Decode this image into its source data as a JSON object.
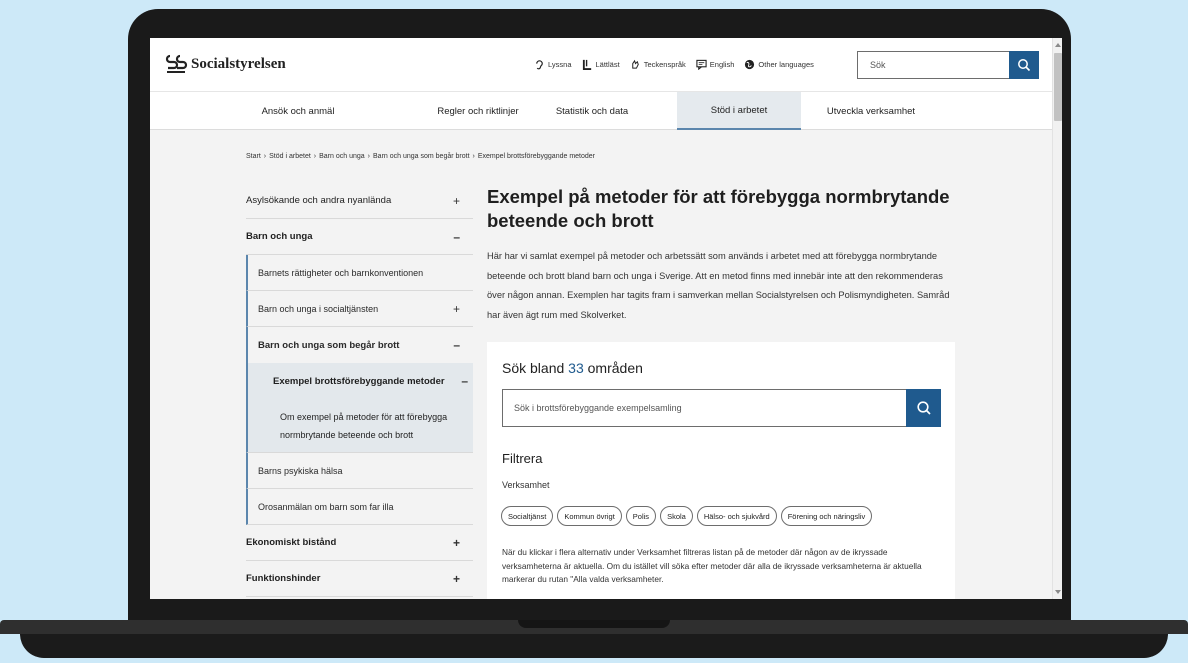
{
  "header": {
    "logo_text": "Socialstyrelsen",
    "tools": [
      {
        "icon": "ear-icon",
        "label": "Lyssna"
      },
      {
        "icon": "easy-read-icon",
        "label": "Lättläst"
      },
      {
        "icon": "sign-language-icon",
        "label": "Teckenspråk"
      },
      {
        "icon": "chat-bubble-icon",
        "label": "English"
      },
      {
        "icon": "globe-icon",
        "label": "Other languages"
      }
    ],
    "search_placeholder": "Sök"
  },
  "nav": {
    "items": [
      {
        "label": "Ansök och anmäl"
      },
      {
        "label": "Regler och riktlinjer"
      },
      {
        "label": "Statistik och data"
      },
      {
        "label": "Stöd i arbetet",
        "active": true
      },
      {
        "label": "Utveckla verksamhet"
      }
    ]
  },
  "breadcrumb": [
    "Start",
    "Stöd i arbetet",
    "Barn och unga",
    "Barn och unga som begår brott",
    "Exempel brottsförebyggande metoder"
  ],
  "sidebar": {
    "items": [
      {
        "label": "Asylsökande och andra nyanlända",
        "sign": "+"
      },
      {
        "label": "Barn och unga",
        "sign": "–"
      },
      {
        "label": "Barnets rättigheter och barnkonventionen"
      },
      {
        "label": "Barn och unga i socialtjänsten",
        "sign": "+"
      },
      {
        "label": "Barn och unga som begår brott",
        "sign": "–"
      },
      {
        "label": "Exempel brottsförebyggande metoder",
        "sign": "–"
      },
      {
        "label_line1": "Om exempel på metoder för att förebygga",
        "label_line2": "normbrytande beteende och brott"
      },
      {
        "label": "Barns psykiska hälsa"
      },
      {
        "label": "Orosanmälan om barn som far illa"
      },
      {
        "label": "Ekonomiskt bistånd",
        "sign": "+"
      },
      {
        "label": "Funktionshinder",
        "sign": "+"
      }
    ]
  },
  "main": {
    "title": "Exempel på metoder för att förebygga normbrytande beteende och brott",
    "intro": "Här har vi samlat exempel på metoder och arbetssätt som används i arbetet med att förebygga normbrytande beteende och brott bland barn och unga i Sverige. Att en metod finns med innebär inte att den rekommenderas över någon annan. Exemplen har tagits fram i samverkan mellan Socialstyrelsen och Polismyndigheten. Samråd har även ägt rum med Skolverket."
  },
  "panel": {
    "title_prefix": "Sök bland",
    "count": "33",
    "title_suffix": "områden",
    "search_placeholder": "Sök i brottsförebyggande exempelsamling",
    "filter_title": "Filtrera",
    "filter_sub": "Verksamhet",
    "chips": [
      "Socialtjänst",
      "Kommun övrigt",
      "Polis",
      "Skola",
      "Hälso- och sjukvård",
      "Förening och näringsliv"
    ],
    "help_text": "När du klickar i flera alternativ under Verksamhet filtreras listan på de metoder där någon av de ikryssade verksamheterna är aktuella. Om du istället vill söka efter metoder där alla de ikryssade verksamheterna är aktuella markerar du rutan \"Alla valda verksamheter."
  },
  "colors": {
    "accent": "#1f5a8e",
    "nav_active_bg": "#e5eaee",
    "page_bg": "#f3f3f3",
    "backdrop": "#cde9f8"
  }
}
